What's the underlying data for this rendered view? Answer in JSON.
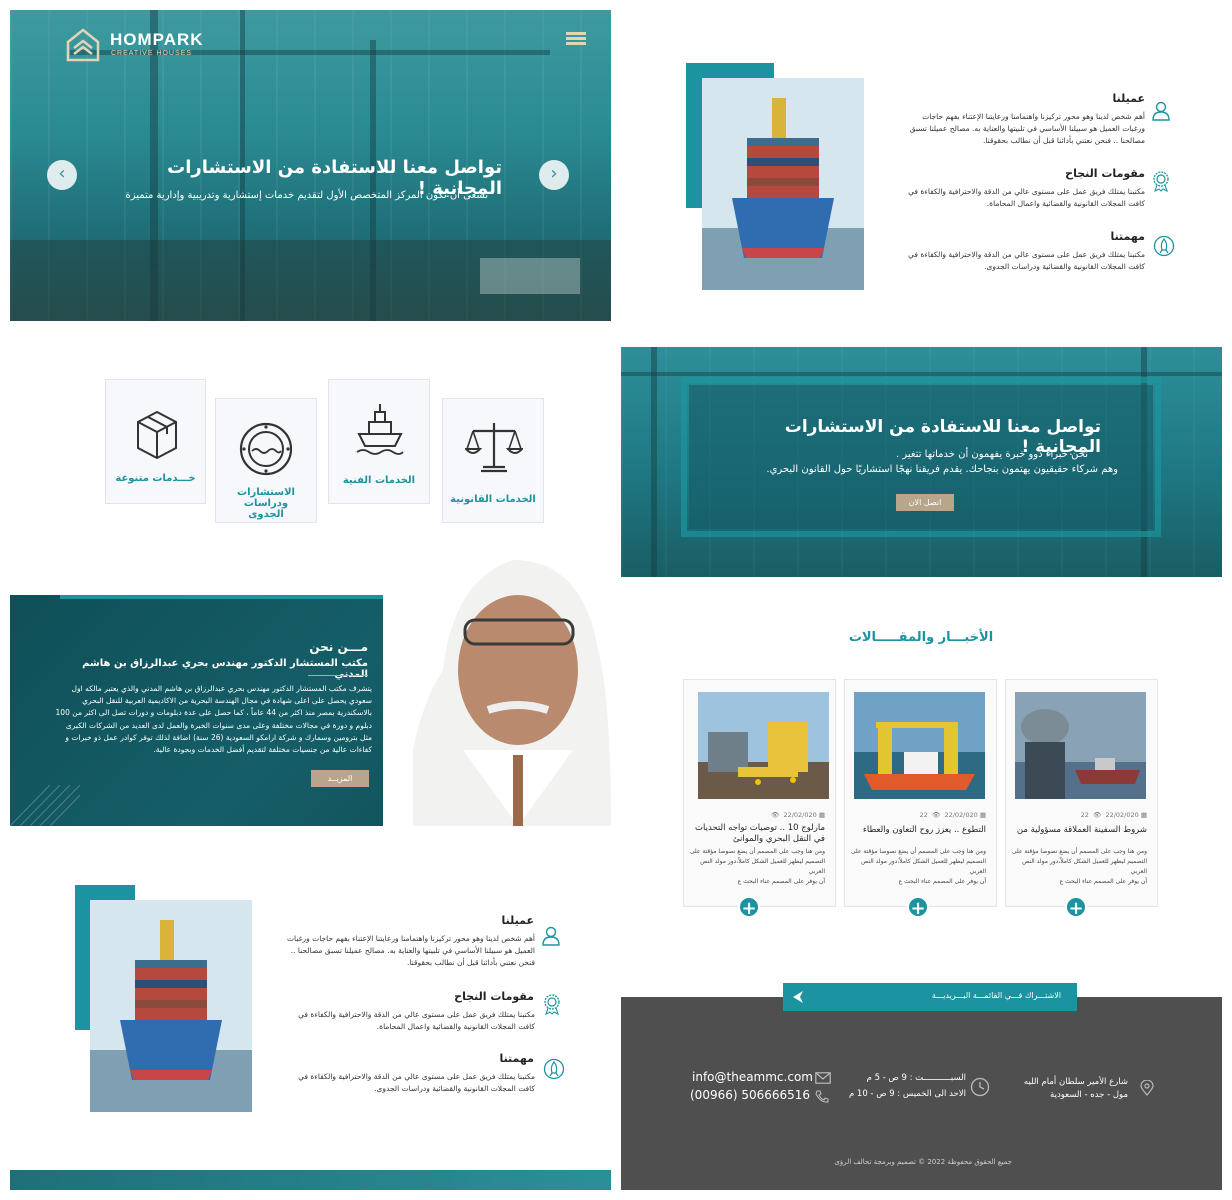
{
  "hero": {
    "brand": "HOMPARK",
    "brand_tagline": "CREATIVE HOUSES",
    "title": "تواصل معنا للاستفادة من الاستشارات المجانية !",
    "subtitle": "نسعى أن نكون المركز المتخصص الأول لتقديم خدمات إستشارية وتدريبية وإدارية متميزة",
    "prev_label": "‹",
    "next_label": "›"
  },
  "features": [
    {
      "title": "عميلنا",
      "text": "أهم شخص لدينا وهو محور تركيزنا واهتمامنا ورعايتنا الإعتناء بفهم حاجات ورغبات العميل هو سبيلنا الأساسي في تلبيتها والعناية به. مصالح عميلنا تسبق مصالحنا .. فنحن نعتني بأدائنا قبل أن نطالب بحقوقنا."
    },
    {
      "title": "مقومات النجاح",
      "text": "مكتبنا يمتلك فريق عمل على مستوى عالي من الدقة والاحترافية والكفاءة في كافت المجلات القانونية والقضائية واعمال المحاماة."
    },
    {
      "title": "مهمتنا",
      "text": "مكتبنا يمتلك فريق عمل على مستوى عالي من الدقة والاحترافية والكفاءة في كافت المجلات القانونية والقضائية ودراسات الجدوى."
    }
  ],
  "services": [
    {
      "label": "خـــدمات متنوعة",
      "icon": "box-icon"
    },
    {
      "label": "الاستشارات ودراسات الجدوى",
      "icon": "porthole-icon"
    },
    {
      "label": "الخدمات الفنية",
      "icon": "ship-icon"
    },
    {
      "label": "الخدمات القانونية",
      "icon": "scales-icon"
    }
  ],
  "cta": {
    "title": "تواصل معنا للاستفادة من الاستشارات المجانية !",
    "line1": "نحن خبراء ذوو خبرة يفهمون أن خدماتها تتغير .",
    "line2": "وهم شركاء حقيقيون يهتمون بنجاحك. يقدم فريقنا نهجًا استشاريًا حول القانون البحري.",
    "button": "اتصل الان"
  },
  "about": {
    "title": "مـــن نحن",
    "subtitle": "مكتب المستشار الدكتور مهندس بحري عبدالرزاق بن هاشم المدني",
    "lines": [
      "يتشرف مكتب المستشار الدكتور مهندس بحري عبدالرزاق بن هاشم المدني والذي يعتبر مالكه اول",
      "سعودي يحصل على اعلى شهادة في مجال الهندسة البحرية من الاكاديمية العربية للنقل البحري",
      "بالاسكندرية بمصر منذ اكثر من 44 عاماً ، كما حصل على عدة دبلومات و دورات تصل الى اكثر من 100",
      "دبلوم و دورة في مجالات مختلفة وعلى مدى سنوات الخبرة والعمل لدى العديد من الشركات الكبرى",
      "مثل بترومين وسمارك و شركة ارامكو السعودية (26 سنة) اضافة لذلك توفر كوادر عمل ذو خبرات و",
      "كفاءات عالية من جنسيات مختلفة لتقديم أفضل الخدمات وبجودة عالية."
    ],
    "button": "المزيــد"
  },
  "news": {
    "title": "الأخبـــار والمقـــــالات",
    "items": [
      {
        "date": "22/02/020",
        "views": "22",
        "headline": "شروط السفينة العملاقة مسؤولية من",
        "text": [
          "ومن هنا وجب على المصمم أن يضع نصوصا مؤقتة على",
          "التصميم ليظهر للعميل الشكل كاملاً،دور مولد النص العربي",
          "أن يوفر على المصمم عناء البحث ع"
        ]
      },
      {
        "date": "22/02/020",
        "views": "22",
        "headline": "التطوع .. يعزز روح التعاون والعطاء",
        "text": [
          "ومن هنا وجب على المصمم أن يضع نصوصا مؤقتة على",
          "التصميم ليظهر للعميل الشكل كاملاً،دور مولد النص العربي",
          "أن يوفر على المصمم عناء البحث ع"
        ]
      },
      {
        "date": "22/02/020",
        "views": "",
        "headline": "مارلوج 10 .. توصيات تواجه التحديات في النقل البحري والموانئ",
        "text": [
          "ومن هنا وجب على المصمم أن يضع نصوصا مؤقتة على",
          "التصميم ليظهر للعميل الشكل كاملاً،دور مولد النص العربي",
          "أن يوفر على المصمم عناء البحث ع"
        ]
      }
    ],
    "more": "+"
  },
  "footer": {
    "newsletter": "الاشتـــراك فـــي القائمـــة البـــريديـــة",
    "address_1": "شارع الأمير سلطان أمام الليه",
    "address_2": "مول - جده - السعودية",
    "hours_1": "السبـــــــــــت : 9 ص - 5 م",
    "hours_2": "الاحد الى الخميس : 9 ص - 10 م",
    "email": "info@theammc.com",
    "phone": "(00966)  506666516",
    "copyright": "جميع الحقوق محفوظة 2022 © تصميم وبرمجة تحالف الرؤى"
  },
  "colors": {
    "primary": "#1b93a0",
    "accent": "#b8a58a",
    "dark": "#4f4f4f"
  }
}
